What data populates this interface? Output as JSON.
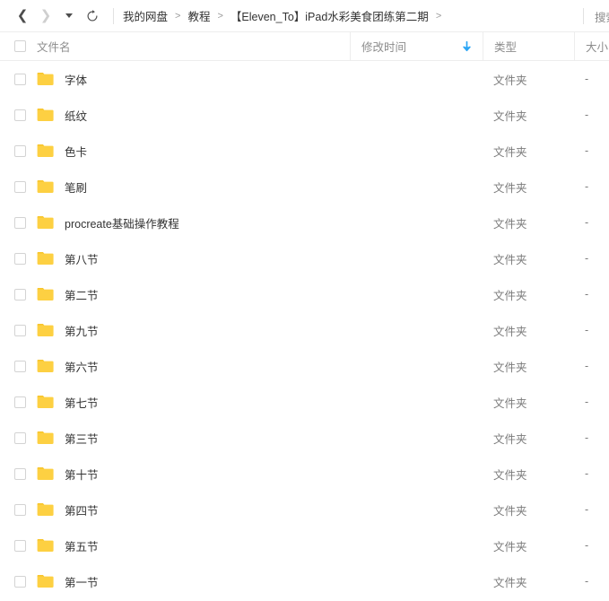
{
  "toolbar": {
    "back_icon": "chevron-left-icon",
    "forward_icon": "chevron-right-icon",
    "dropdown_icon": "caret-down-icon",
    "refresh_icon": "refresh-icon"
  },
  "breadcrumb": {
    "items": [
      "我的网盘",
      "教程",
      "【Eleven_To】iPad水彩美食团练第二期"
    ],
    "separator": ">",
    "trailing_separator": ">"
  },
  "search": {
    "label": "搜索",
    "icon": "search-icon"
  },
  "table": {
    "headers": {
      "select_all": "select-all-checkbox",
      "name": "文件名",
      "time": "修改时间",
      "type": "类型",
      "size": "大小",
      "sort_icon": "arrow-down-icon",
      "sort_color": "#2ca6f5"
    },
    "rows": [
      {
        "name": "字体",
        "time": "",
        "type": "文件夹",
        "size": "-"
      },
      {
        "name": "纸纹",
        "time": "",
        "type": "文件夹",
        "size": "-"
      },
      {
        "name": "色卡",
        "time": "",
        "type": "文件夹",
        "size": "-"
      },
      {
        "name": "笔刷",
        "time": "",
        "type": "文件夹",
        "size": "-"
      },
      {
        "name": "procreate基础操作教程",
        "time": "",
        "type": "文件夹",
        "size": "-"
      },
      {
        "name": "第八节",
        "time": "",
        "type": "文件夹",
        "size": "-"
      },
      {
        "name": "第二节",
        "time": "",
        "type": "文件夹",
        "size": "-"
      },
      {
        "name": "第九节",
        "time": "",
        "type": "文件夹",
        "size": "-"
      },
      {
        "name": "第六节",
        "time": "",
        "type": "文件夹",
        "size": "-"
      },
      {
        "name": "第七节",
        "time": "",
        "type": "文件夹",
        "size": "-"
      },
      {
        "name": "第三节",
        "time": "",
        "type": "文件夹",
        "size": "-"
      },
      {
        "name": "第十节",
        "time": "",
        "type": "文件夹",
        "size": "-"
      },
      {
        "name": "第四节",
        "time": "",
        "type": "文件夹",
        "size": "-"
      },
      {
        "name": "第五节",
        "time": "",
        "type": "文件夹",
        "size": "-"
      },
      {
        "name": "第一节",
        "time": "",
        "type": "文件夹",
        "size": "-"
      }
    ]
  },
  "colors": {
    "folder": "#fdd042",
    "folder_dark": "#f8c52c",
    "accent": "#2ca6f5",
    "border": "#ededed",
    "text": "#333333",
    "muted": "#8c8c8c"
  }
}
